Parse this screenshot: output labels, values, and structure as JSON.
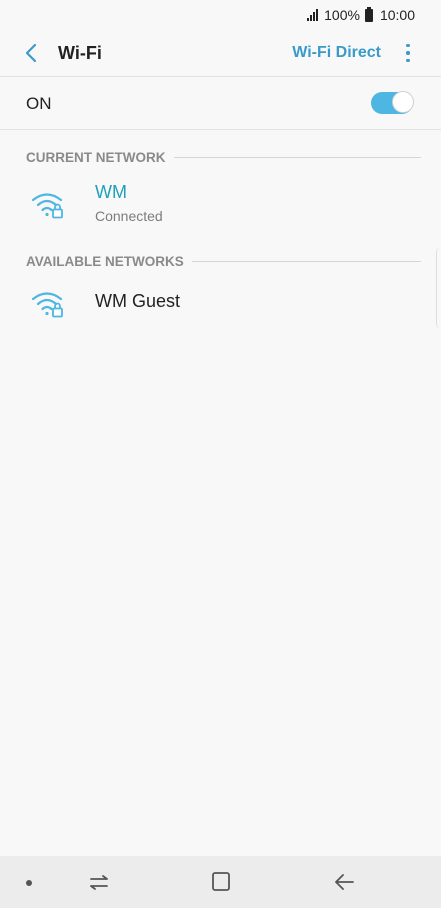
{
  "status_bar": {
    "battery_text": "100%",
    "time": "10:00",
    "icons": [
      "signal-icon",
      "battery-icon"
    ]
  },
  "app_bar": {
    "title": "Wi-Fi",
    "action_label": "Wi-Fi Direct",
    "icons": [
      "back-arrow-icon",
      "more-options-icon"
    ]
  },
  "wifi_switch": {
    "label": "ON",
    "enabled": true
  },
  "current_network": {
    "header": "CURRENT NETWORK",
    "items": [
      {
        "name": "WM",
        "status": "Connected",
        "icon": "wifi-lock-icon"
      }
    ]
  },
  "available_networks": {
    "header": "AVAILABLE NETWORKS",
    "items": [
      {
        "name": "WM Guest",
        "icon": "wifi-lock-icon"
      }
    ]
  },
  "nav_bar": {
    "icons": [
      "recent-apps-icon",
      "home-icon",
      "back-icon"
    ]
  },
  "colors": {
    "accent": "#3a9bc8",
    "connected": "#1fa0b8",
    "toggle_on": "#4db6e2",
    "wifi_icon": "#4db6e2"
  }
}
